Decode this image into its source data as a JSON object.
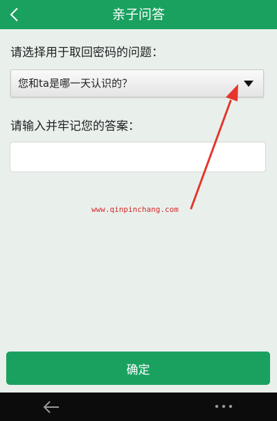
{
  "header": {
    "back_icon": "chevron-left-icon",
    "title": "亲子问答"
  },
  "question": {
    "label": "请选择用于取回密码的问题：",
    "selected": "您和ta是哪一天认识的？",
    "dropdown_icon": "caret-down-icon"
  },
  "answer": {
    "label": "请输入并牢记您的答案：",
    "value": "",
    "placeholder": ""
  },
  "watermark": "www.qinpinchang.com",
  "annotation": {
    "color": "#e5352c"
  },
  "confirm": {
    "label": "确定"
  },
  "navbar": {
    "back_icon": "back-arrow-icon",
    "more_icon": "more-dots-icon"
  },
  "colors": {
    "accent": "#1aa160",
    "background": "#e9f0ec",
    "navbar": "#0c0c0c"
  }
}
